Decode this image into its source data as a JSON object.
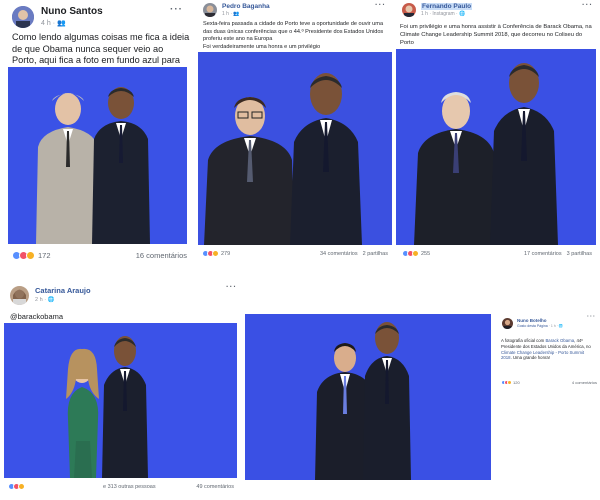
{
  "posts": [
    {
      "author": "Nuno Santos",
      "time": "4 h",
      "text": "Como lendo algumas coisas me fica a ideia de que Obama nunca sequer veio ao Porto, aqui fica a foto em fundo azul para provar.",
      "reactions": "172",
      "comments": "16 comentários"
    },
    {
      "author": "Pedro Baganha",
      "time": "1 h",
      "text": "Sexta-feira passada a cidade do Porto teve a oportunidade de ouvir uma das duas únicas conferências que o 44.º Presidente dos Estados Unidos proferiu este ano na Europa",
      "text2": "Foi verdadeiramente uma honra e um privilégio",
      "reactions": "279",
      "comments": "34 comentários",
      "shares": "2 partilhas"
    },
    {
      "author": "Fernando Paulo",
      "time": "1 h",
      "via": "Instagram",
      "text": "Foi um privilégio e uma honra assistir à Conferência de Barack Obama, na Climate Change Leadership Summit 2018, que decorreu no Coliseu do Porto",
      "reactions": "255",
      "comments": "17 comentários",
      "shares": "3 partilhas"
    },
    {
      "author": "Catarina Araujo",
      "time": "2 h",
      "text": "@barackobama",
      "reactions": "e 313 outras pessoas",
      "comments": "49 comentários"
    },
    {
      "author": "Nuno Botelho",
      "subtitle": "Gosto desta Página",
      "time": "1 h",
      "text_a": "A fotografia oficial com ",
      "link_a": "Barack Obama",
      "text_b": ", 44º Presidente dos Estados Unidos da América, no ",
      "link_b": "Climate Change Leadership - Porto Summit 2018",
      "text_c": ". Uma grande honra!",
      "reactions": "120",
      "comments": "4 comentários"
    }
  ],
  "more_glyph": "···",
  "colors": {
    "backdrop": "#3a52e6",
    "link": "#365899",
    "meta": "#90949c"
  }
}
